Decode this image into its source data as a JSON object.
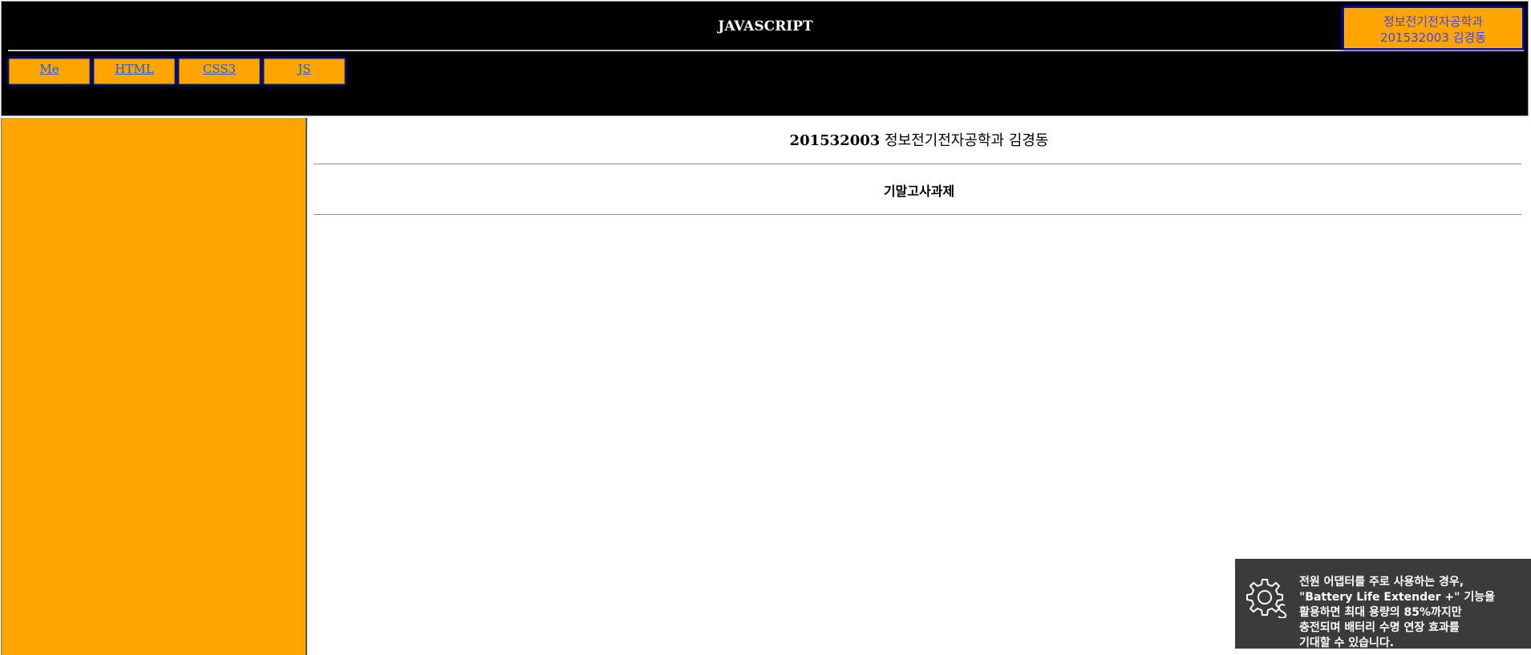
{
  "header": {
    "title": "JAVASCRIPT",
    "author_line1": "정보전기전자공학과",
    "author_line2": "201532003 김경동",
    "nav": [
      {
        "label": "Me"
      },
      {
        "label": "HTML"
      },
      {
        "label": "CSS3"
      },
      {
        "label": "JS"
      }
    ]
  },
  "main": {
    "title_id": "201532003",
    "title_name": " 정보전기전자공학과 김경동",
    "subtitle": "기말고사과제"
  },
  "toast": {
    "icon": "battery-settings-gear-icon",
    "message": "전원 어댑터를 주로 사용하는 경우,\n\"Battery Life Extender +\" 기능을\n활용하면 최대 용량의 85%까지만\n충전되며 배터리 수명 연장 효과를\n기대할 수 있습니다."
  },
  "colors": {
    "header_bg": "#000000",
    "accent": "#ffa500",
    "link": "#1f5fd6",
    "glow": "#1a1ae0",
    "toast_bg": "#3b3b3b"
  }
}
